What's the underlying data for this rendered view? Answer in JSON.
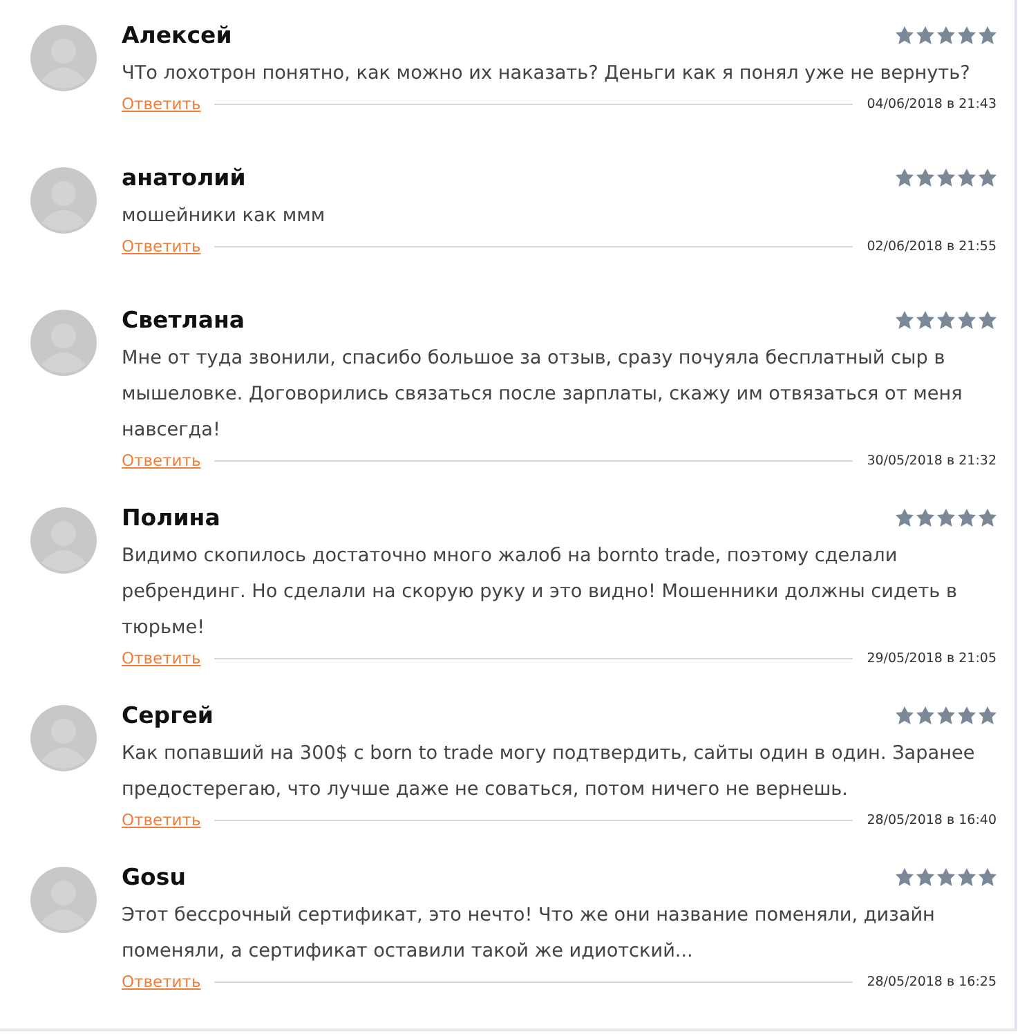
{
  "comments": [
    {
      "author": "Алексей",
      "stars": 5,
      "text": "ЧТо лохотрон понятно, как можно их наказать? Деньги как я понял уже не вернуть?",
      "reply": "Ответить",
      "date": "04/06/2018 в 21:43"
    },
    {
      "author": "анатолий",
      "stars": 5,
      "text": "мошейники как ммм",
      "reply": "Ответить",
      "date": "02/06/2018 в 21:55"
    },
    {
      "author": "Светлана",
      "stars": 5,
      "text": "Мне от туда звонили, спасибо большое за отзыв, сразу почуяла бесплатный сыр в мышеловке. Договорились связаться после зарплаты, скажу им отвязаться от меня навсегда!",
      "reply": "Ответить",
      "date": "30/05/2018 в 21:32"
    },
    {
      "author": "Полина",
      "stars": 5,
      "text": "Видимо скопилось достаточно много жалоб на bornto trade, поэтому сделали ребрендинг. Но сделали на скорую руку и это видно! Мошенники должны сидеть в тюрьме!",
      "reply": "Ответить",
      "date": "29/05/2018 в 21:05"
    },
    {
      "author": "Сергей",
      "stars": 5,
      "text": "Как попавший на 300$ с born to trade могу подтвердить, сайты один в один. Заранее предостерегаю, что лучше даже не соваться, потом ничего не вернешь.",
      "reply": "Ответить",
      "date": "28/05/2018 в 16:40"
    },
    {
      "author": "Gosu",
      "stars": 5,
      "text": "Этот бессрочный сертификат, это нечто! Что же они название поменяли, дизайн поменяли, а сертификат оставили такой же идиотский...",
      "reply": "Ответить",
      "date": "28/05/2018 в 16:25"
    }
  ]
}
